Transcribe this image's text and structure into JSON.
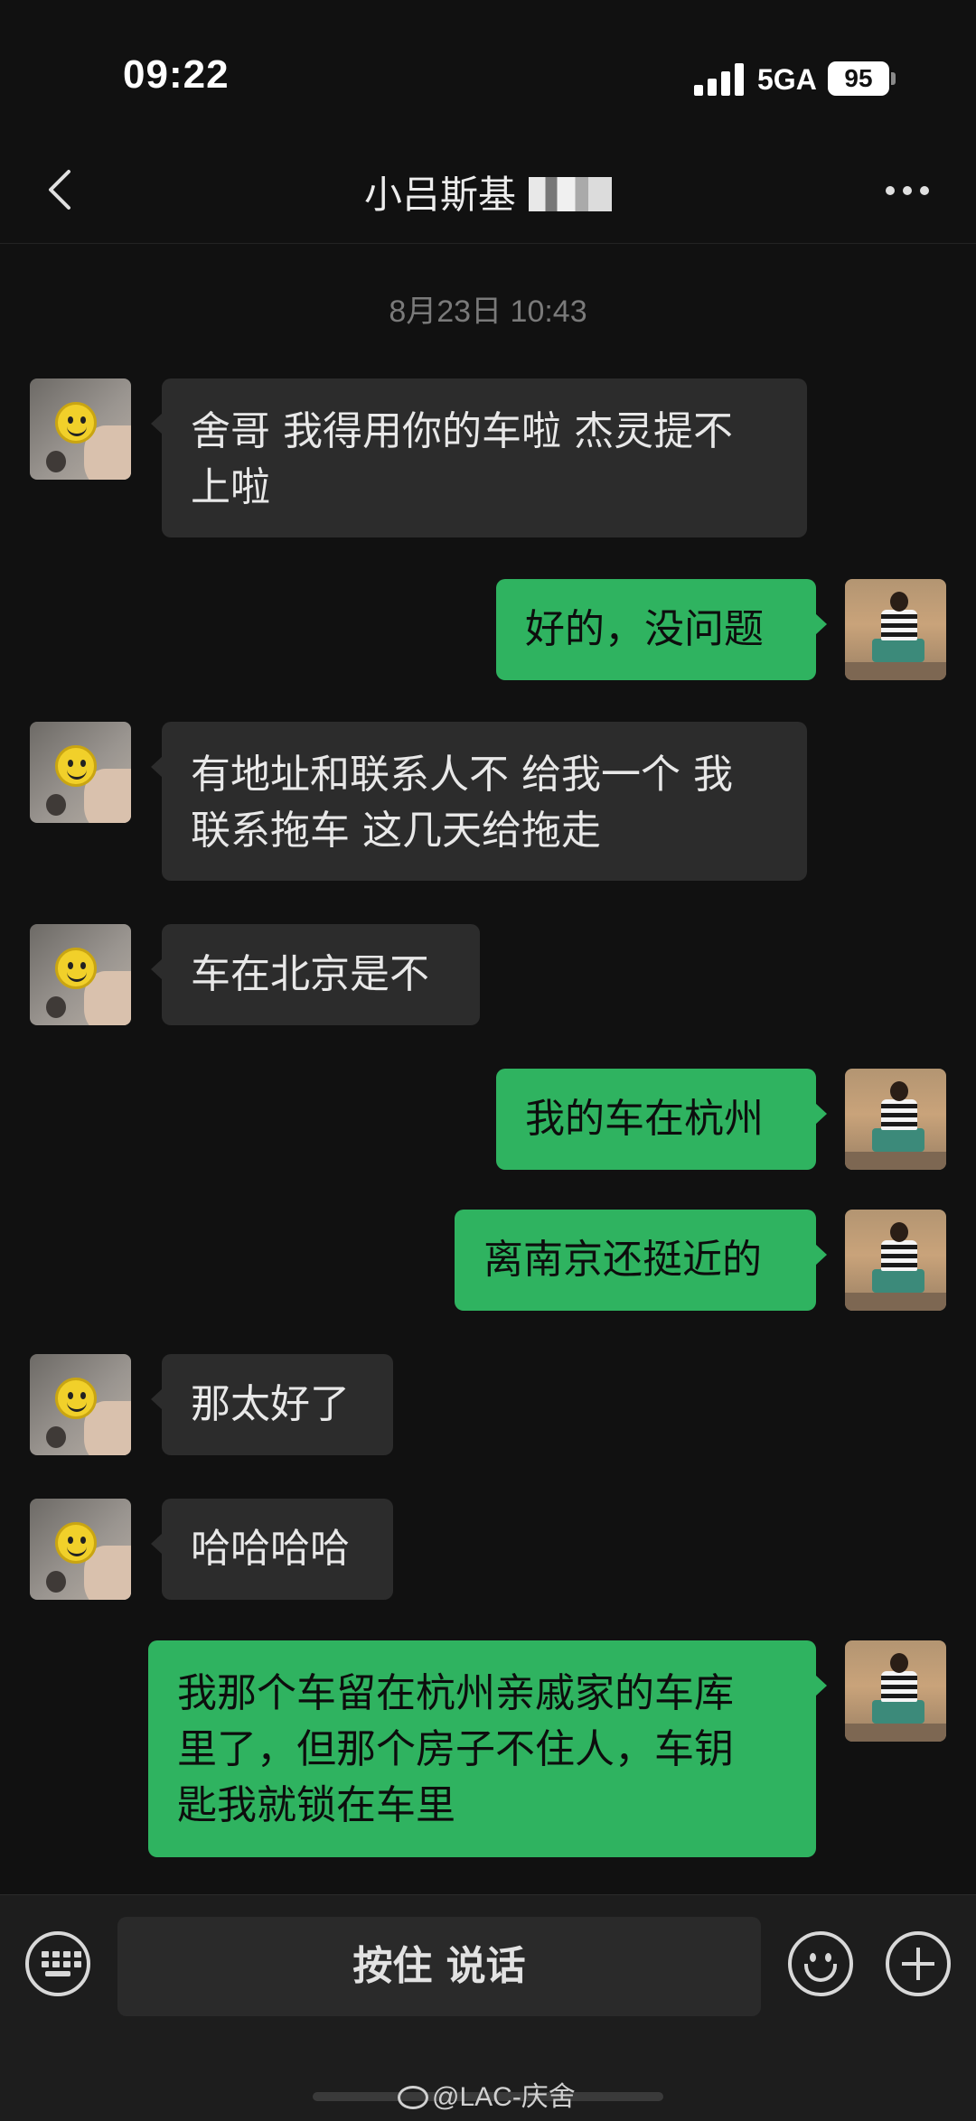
{
  "status_bar": {
    "time": "09:22",
    "network": "5GA",
    "battery": "95"
  },
  "nav": {
    "title": "小吕斯基",
    "back_icon": "chevron-left-icon",
    "more_icon": "more-dots-icon"
  },
  "chat": {
    "timestamp": "8月23日 10:43",
    "messages": [
      {
        "from": "friend",
        "text": "舍哥 我得用你的车啦 杰灵提不\n上啦"
      },
      {
        "from": "self",
        "text": "好的，没问题"
      },
      {
        "from": "friend",
        "text": "有地址和联系人不 给我一个 我\n联系拖车 这几天给拖走"
      },
      {
        "from": "friend",
        "text": "车在北京是不"
      },
      {
        "from": "self",
        "text": "我的车在杭州"
      },
      {
        "from": "self",
        "text": "离南京还挺近的"
      },
      {
        "from": "friend",
        "text": "那太好了"
      },
      {
        "from": "friend",
        "text": "哈哈哈哈"
      },
      {
        "from": "self",
        "text": "我那个车留在杭州亲戚家的车库\n里了，但那个房子不住人，车钥\n匙我就锁在车里"
      }
    ]
  },
  "input_bar": {
    "talk_label": "按住 说话",
    "voice_icon": "keyboard-icon",
    "emoji_icon": "emoji-icon",
    "plus_icon": "plus-icon"
  },
  "watermark": "@LAC-庆舍"
}
